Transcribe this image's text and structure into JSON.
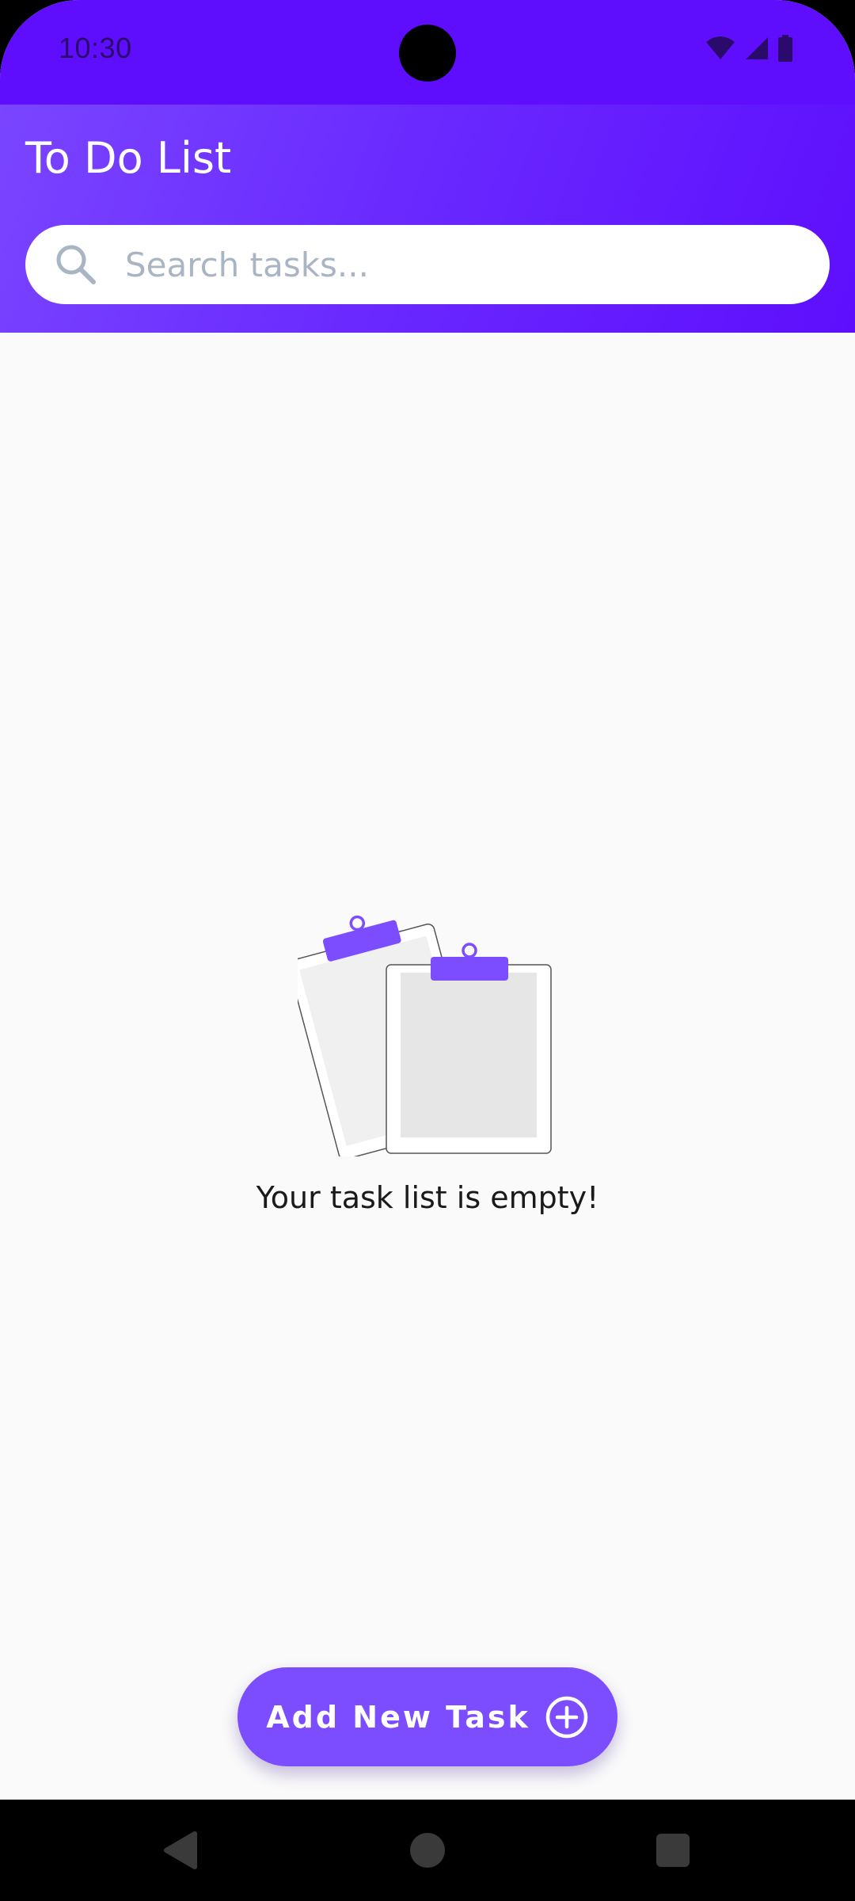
{
  "status_bar": {
    "time": "10:30",
    "icons": [
      "wifi-icon",
      "cellular-signal-icon",
      "battery-icon"
    ]
  },
  "app": {
    "title": "To Do List"
  },
  "search": {
    "placeholder": "Search tasks...",
    "value": ""
  },
  "empty_state": {
    "illustration": "clipboards-illustration",
    "message": "Your task list is empty!"
  },
  "fab": {
    "label": "Add New Task",
    "icon": "plus-circle-icon"
  },
  "nav": {
    "buttons": [
      "back-icon",
      "home-icon",
      "recents-icon"
    ]
  },
  "colors": {
    "status_bar": "#5e0efd",
    "header_gradient_start": "#7a45ff",
    "header_gradient_end": "#5e0efd",
    "accent": "#7c4dff",
    "background": "#fafafa",
    "placeholder_text": "#a9b4c4"
  }
}
